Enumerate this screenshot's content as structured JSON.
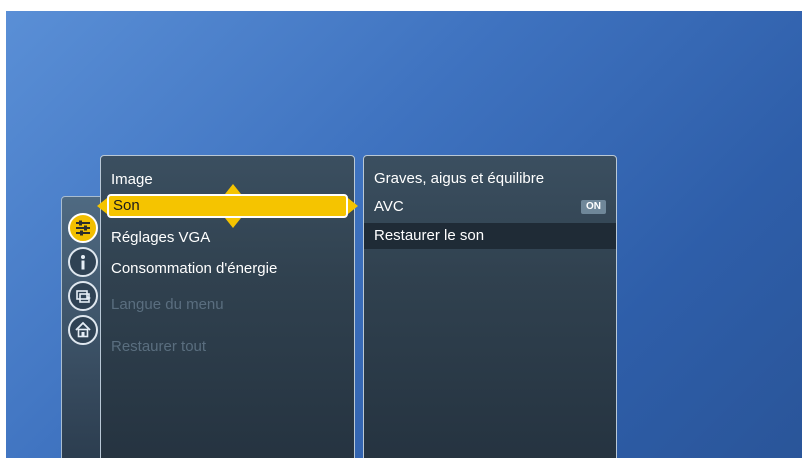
{
  "left_menu": {
    "items": [
      {
        "label": "Image",
        "state": "normal"
      },
      {
        "label": "Son",
        "state": "selected"
      },
      {
        "label": "Réglages VGA",
        "state": "normal"
      },
      {
        "label": "Consommation d'énergie",
        "state": "normal"
      },
      {
        "label": "Langue du menu",
        "state": "disabled"
      },
      {
        "label": "Restaurer tout",
        "state": "disabled"
      }
    ]
  },
  "right_menu": {
    "items": [
      {
        "label": "Graves, aigus et équilibre"
      },
      {
        "label": "AVC",
        "badge": "ON"
      },
      {
        "label": "Restaurer le son"
      }
    ]
  },
  "icons": {
    "settings": "settings-icon",
    "info": "info-icon",
    "sources": "sources-icon",
    "home": "home-icon"
  },
  "colors": {
    "accent": "#f5c400",
    "background_top": "#5a8fd6",
    "background_bottom": "#2a5599"
  }
}
